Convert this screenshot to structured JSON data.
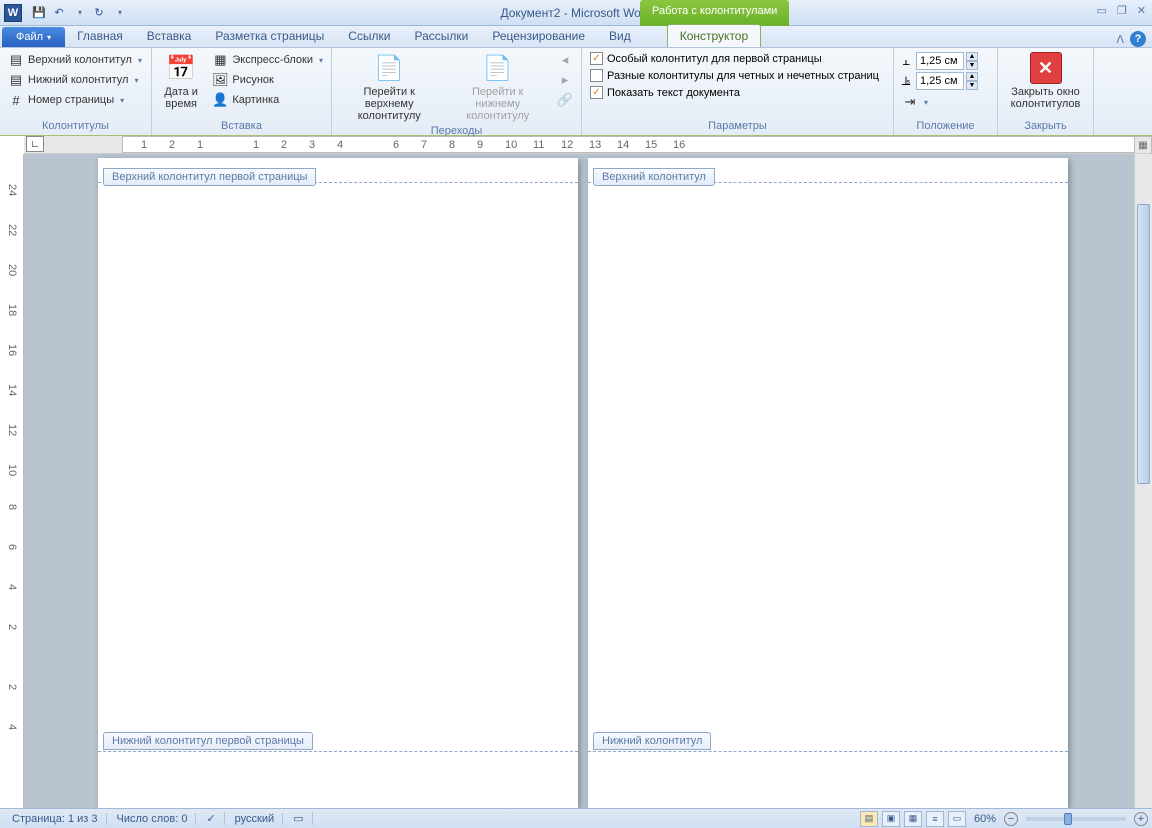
{
  "title": "Документ2 - Microsoft Word",
  "context_tab": "Работа с колонтитулами",
  "tabs": {
    "file": "Файл",
    "items": [
      "Главная",
      "Вставка",
      "Разметка страницы",
      "Ссылки",
      "Рассылки",
      "Рецензирование",
      "Вид"
    ],
    "active": "Конструктор"
  },
  "ribbon": {
    "g1": {
      "label": "Колонтитулы",
      "btns": [
        "Верхний колонтитул",
        "Нижний колонтитул",
        "Номер страницы"
      ]
    },
    "g2": {
      "label": "Вставка",
      "datetime": "Дата и время",
      "btns": [
        "Экспресс-блоки",
        "Рисунок",
        "Картинка"
      ]
    },
    "g3": {
      "label": "Переходы",
      "goto_top": "Перейти к верхнему колонтитулу",
      "goto_bot": "Перейти к нижнему колонтитулу"
    },
    "g4": {
      "label": "Параметры",
      "chk1": "Особый колонтитул для первой страницы",
      "chk2": "Разные колонтитулы для четных и нечетных страниц",
      "chk3": "Показать текст документа"
    },
    "g5": {
      "label": "Положение",
      "val1": "1,25 см",
      "val2": "1,25 см"
    },
    "g6": {
      "label": "Закрыть",
      "close": "Закрыть окно колонтитулов"
    }
  },
  "page_tags": {
    "p1_top": "Верхний колонтитул первой страницы",
    "p1_bot": "Нижний колонтитул первой страницы",
    "p2_top": "Верхний колонтитул",
    "p2_bot": "Нижний колонтитул"
  },
  "status": {
    "page": "Страница: 1 из 3",
    "words": "Число слов: 0",
    "lang": "русский",
    "zoom": "60%"
  }
}
